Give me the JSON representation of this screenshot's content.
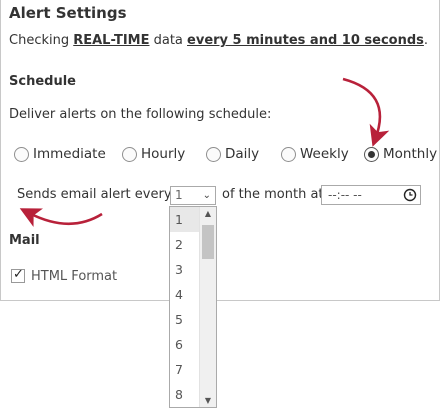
{
  "title": "Alert Settings",
  "checking": {
    "prefix": "Checking ",
    "mode": "REAL-TIME",
    "middle": " data ",
    "interval": "every 5 minutes and 10 seconds",
    "suffix": "."
  },
  "schedule": {
    "heading": "Schedule",
    "deliver_text": "Deliver alerts on the following schedule:",
    "options": [
      "Immediate",
      "Hourly",
      "Daily",
      "Weekly",
      "Monthly"
    ],
    "selected": "Monthly"
  },
  "monthly": {
    "sends_label": "Sends email alert every",
    "day_value": "1",
    "of_month_label": "of the month at",
    "time_value": "--:-- --"
  },
  "mail": {
    "heading": "Mail",
    "html_format_label": "HTML Format",
    "html_format_checked": true
  },
  "day_dropdown": {
    "visible_options": [
      "1",
      "2",
      "3",
      "4",
      "5",
      "6",
      "7",
      "8"
    ],
    "highlighted": "1"
  },
  "colors": {
    "annotation_arrow": "#b8213a"
  }
}
